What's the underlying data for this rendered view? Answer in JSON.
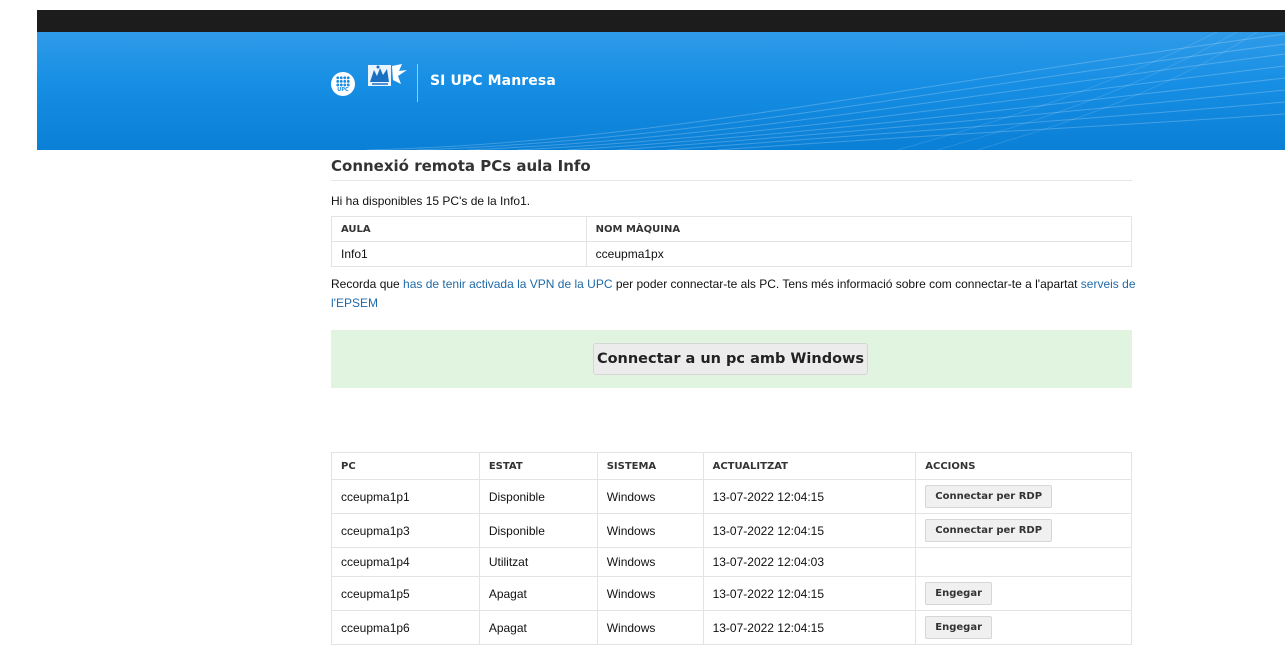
{
  "header": {
    "site_name": "SI UPC Manresa",
    "logo_text": "UPC"
  },
  "page": {
    "title": "Connexió remota PCs aula Info",
    "intro": "Hi ha disponibles 15 PC's de la Info1."
  },
  "aula_table": {
    "headers": [
      "AULA",
      "NOM MÀQUINA"
    ],
    "row": [
      "Info1",
      "cceupma1px"
    ]
  },
  "vpn_note": {
    "prefix": "Recorda que ",
    "link1": "has de tenir activada la VPN de la UPC",
    "middle": " per poder connectar-te als PC. Tens més informació sobre com connectar-te a l'apartat ",
    "link2": "serveis de l'EPSEM"
  },
  "connect_button": "Connectar a un pc amb Windows",
  "pc_table": {
    "headers": [
      "PC",
      "ESTAT",
      "SISTEMA",
      "ACTUALITZAT",
      "ACCIONS"
    ],
    "rows": [
      {
        "pc": "cceupma1p1",
        "estat": "Disponible",
        "sistema": "Windows",
        "actualitzat": "13-07-2022 12:04:15",
        "accio": "Connectar per RDP"
      },
      {
        "pc": "cceupma1p3",
        "estat": "Disponible",
        "sistema": "Windows",
        "actualitzat": "13-07-2022 12:04:15",
        "accio": "Connectar per RDP"
      },
      {
        "pc": "cceupma1p4",
        "estat": "Utilitzat",
        "sistema": "Windows",
        "actualitzat": "13-07-2022 12:04:03",
        "accio": ""
      },
      {
        "pc": "cceupma1p5",
        "estat": "Apagat",
        "sistema": "Windows",
        "actualitzat": "13-07-2022 12:04:15",
        "accio": "Engegar"
      },
      {
        "pc": "cceupma1p6",
        "estat": "Apagat",
        "sistema": "Windows",
        "actualitzat": "13-07-2022 12:04:15",
        "accio": "Engegar"
      }
    ]
  },
  "colors": {
    "banner_blue": "#168ee4",
    "connect_box_green": "#e1f4e0",
    "link_blue": "#1f6aa8"
  }
}
